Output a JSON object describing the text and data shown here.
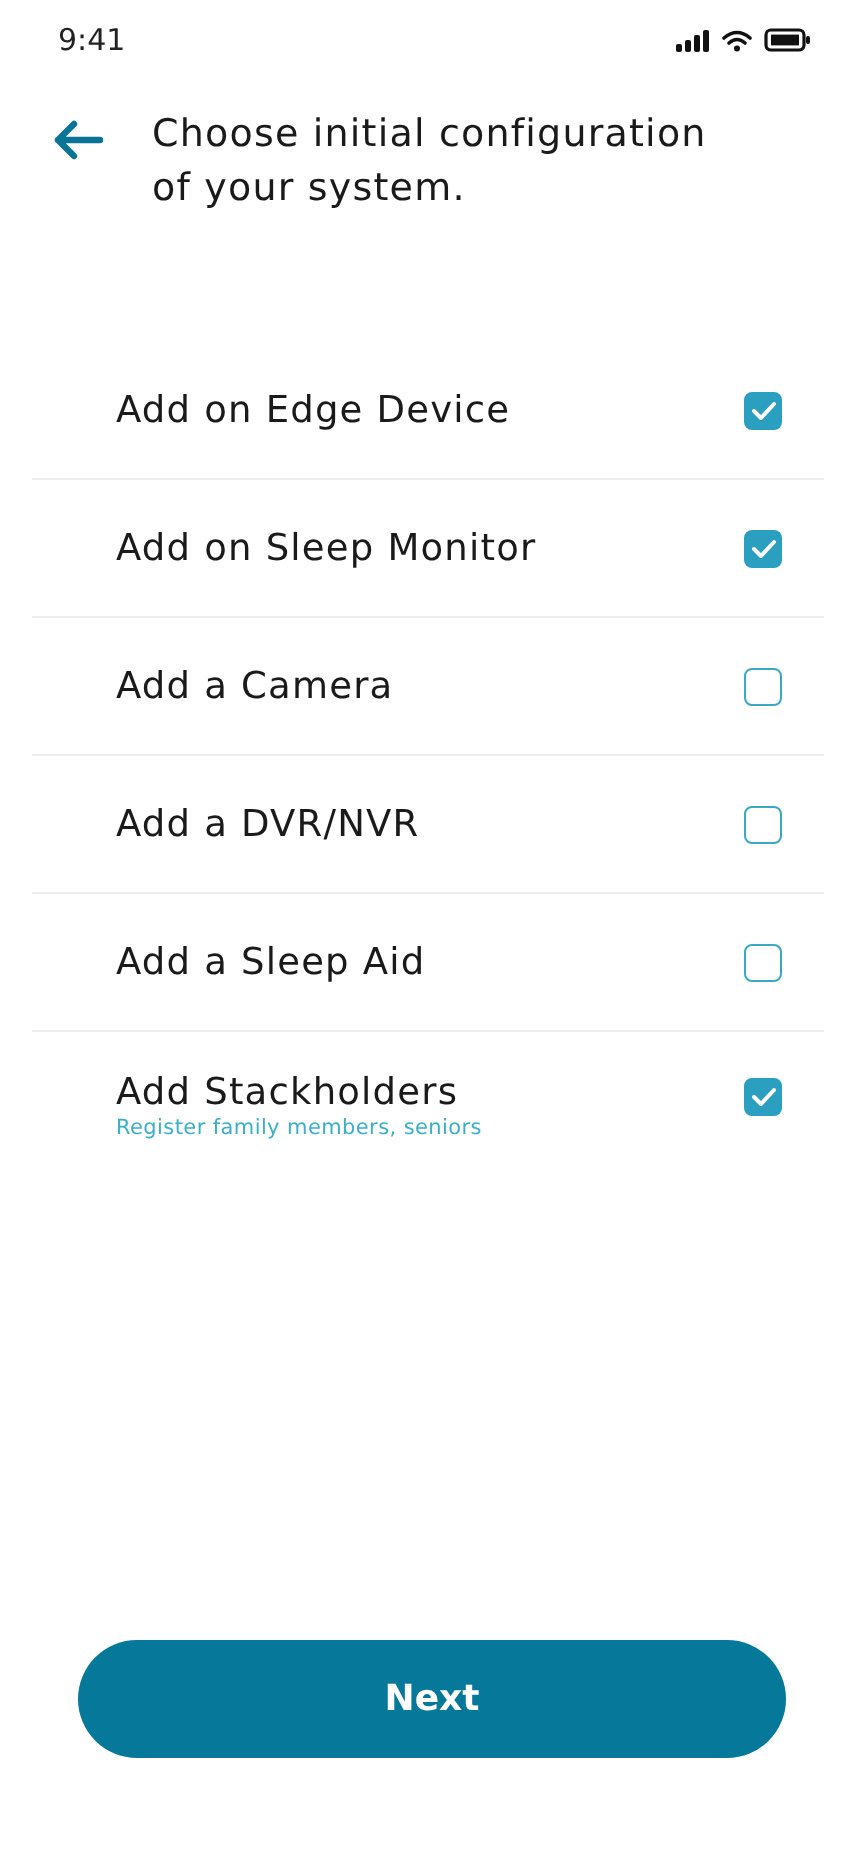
{
  "status_bar": {
    "time": "9:41"
  },
  "header": {
    "title": "Choose initial configuration of your system."
  },
  "options": [
    {
      "label": "Add on Edge Device",
      "checked": true
    },
    {
      "label": "Add on Sleep Monitor",
      "checked": true
    },
    {
      "label": "Add a Camera",
      "checked": false
    },
    {
      "label": "Add a DVR/NVR",
      "checked": false
    },
    {
      "label": "Add a Sleep Aid",
      "checked": false
    },
    {
      "label": "Add Stackholders",
      "subtitle": "Register family members, seniors",
      "checked": true
    }
  ],
  "button": {
    "label": "Next"
  }
}
